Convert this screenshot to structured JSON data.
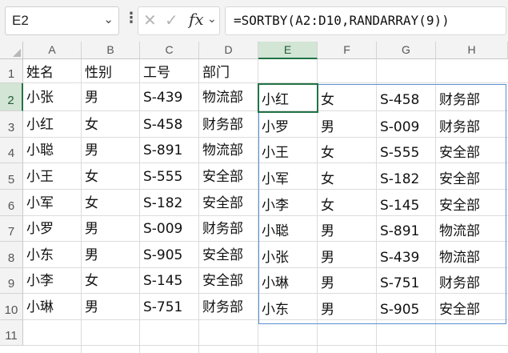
{
  "formula_bar": {
    "name_box": "E2",
    "name_box_arrow_icon": "chevron-down-icon",
    "more_icon": "vertical-ellipsis-icon",
    "cancel_glyph": "✕",
    "enter_glyph": "✓",
    "fx_label": "fx",
    "formula": "=SORTBY(A2:D10,RANDARRAY(9))"
  },
  "columns": [
    "A",
    "B",
    "C",
    "D",
    "E",
    "F",
    "G",
    "H"
  ],
  "rows": [
    "1",
    "2",
    "3",
    "4",
    "5",
    "6",
    "7",
    "8",
    "9",
    "10",
    "11"
  ],
  "active_cell": {
    "column": "E",
    "row": "2"
  },
  "source_table": {
    "headers": [
      "姓名",
      "性别",
      "工号",
      "部门"
    ],
    "rows": [
      [
        "小张",
        "男",
        "S-439",
        "物流部"
      ],
      [
        "小红",
        "女",
        "S-458",
        "财务部"
      ],
      [
        "小聪",
        "男",
        "S-891",
        "物流部"
      ],
      [
        "小王",
        "女",
        "S-555",
        "安全部"
      ],
      [
        "小军",
        "女",
        "S-182",
        "安全部"
      ],
      [
        "小罗",
        "男",
        "S-009",
        "财务部"
      ],
      [
        "小东",
        "男",
        "S-905",
        "安全部"
      ],
      [
        "小李",
        "女",
        "S-145",
        "安全部"
      ],
      [
        "小琳",
        "男",
        "S-751",
        "财务部"
      ]
    ]
  },
  "spill_result": {
    "rows": [
      [
        "小红",
        "女",
        "S-458",
        "财务部"
      ],
      [
        "小罗",
        "男",
        "S-009",
        "财务部"
      ],
      [
        "小王",
        "女",
        "S-555",
        "安全部"
      ],
      [
        "小军",
        "女",
        "S-182",
        "安全部"
      ],
      [
        "小李",
        "女",
        "S-145",
        "安全部"
      ],
      [
        "小聪",
        "男",
        "S-891",
        "物流部"
      ],
      [
        "小张",
        "男",
        "S-439",
        "物流部"
      ],
      [
        "小琳",
        "男",
        "S-751",
        "财务部"
      ],
      [
        "小东",
        "男",
        "S-905",
        "安全部"
      ]
    ]
  },
  "colors": {
    "grid_line": "#dcdcdc",
    "header_bg": "#f3f3f3",
    "active_header_bg": "#d3e5d5",
    "active_cell_border": "#217346",
    "spill_border": "#5b8fd0"
  }
}
